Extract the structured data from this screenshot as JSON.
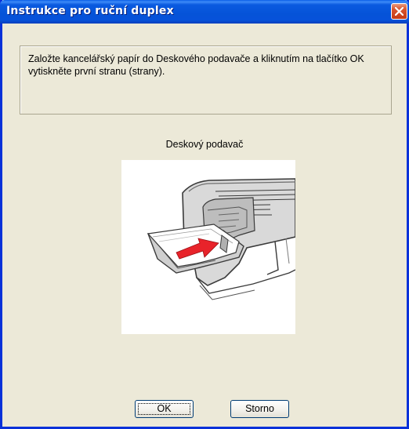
{
  "window": {
    "title": "Instrukce pro ruční duplex"
  },
  "instructions": {
    "text": "Založte kancelářský papír do Deskového podavače a kliknutím na tlačítko OK vytiskněte první stranu (strany)."
  },
  "illustration": {
    "label": "Deskový podavač"
  },
  "buttons": {
    "ok_label": "OK",
    "cancel_label": "Storno"
  },
  "colors": {
    "titlebar": "#0553D8",
    "window_background": "#ECE9D8",
    "close_button": "#D8552E",
    "arrow": "#E8232A"
  }
}
